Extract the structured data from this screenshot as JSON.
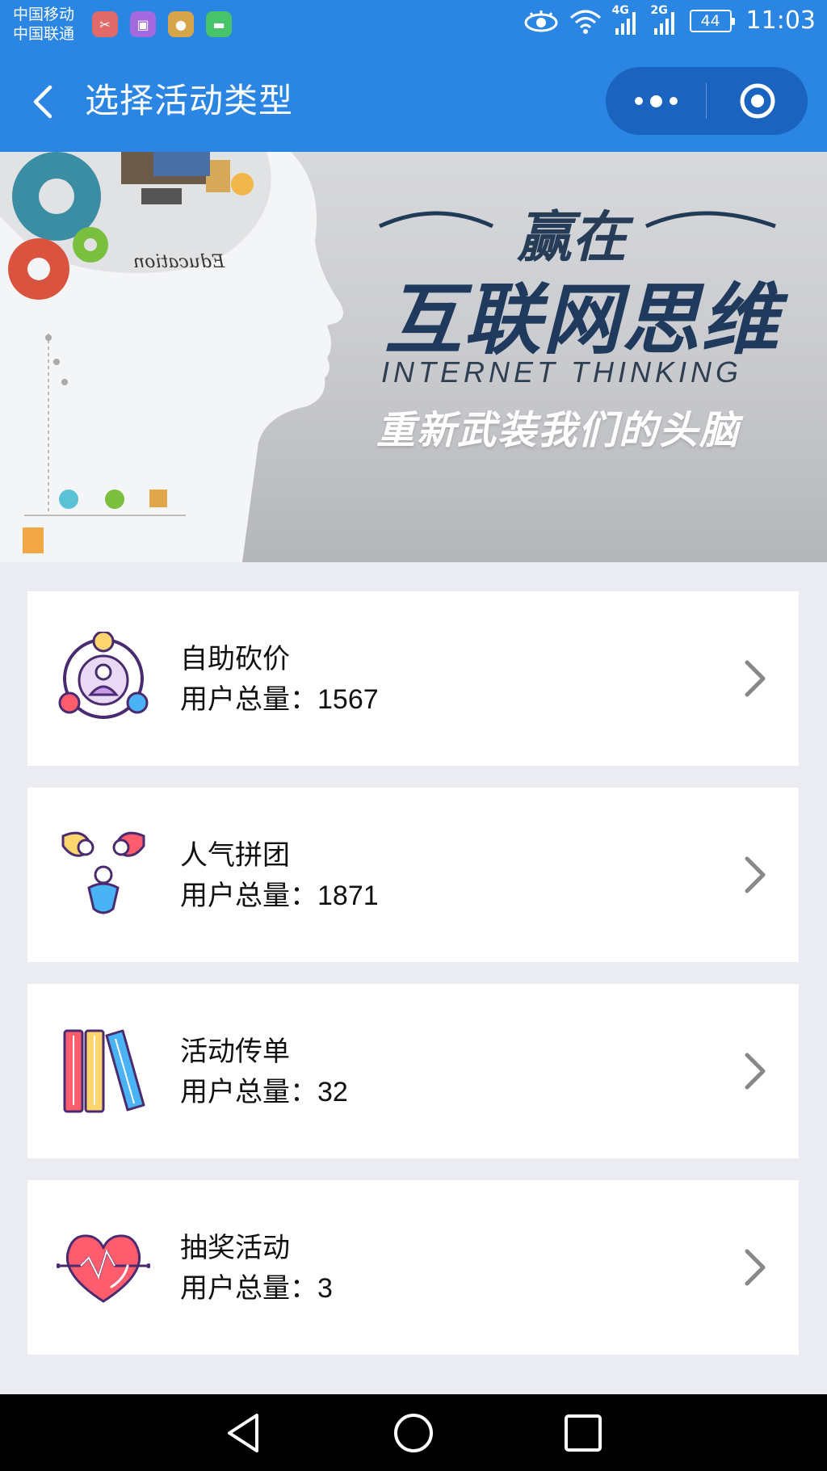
{
  "status_bar": {
    "carrier_1": "中国移动",
    "carrier_2": "中国联通",
    "net_1": "4G",
    "net_2": "2G",
    "battery": "44",
    "time": "11:03",
    "app_icons": [
      {
        "name": "scissors-app-icon",
        "color": "#e06a6a"
      },
      {
        "name": "image-app-icon",
        "color": "#a36ae0"
      },
      {
        "name": "badge-app-icon",
        "color": "#d7a64a"
      },
      {
        "name": "message-app-icon",
        "color": "#47c46a"
      }
    ]
  },
  "nav": {
    "title": "选择活动类型"
  },
  "banner": {
    "line_1": "赢在",
    "line_2": "互联网思维",
    "line_3": "INTERNET THINKING",
    "line_4": "重新武装我们的头脑",
    "edu_text": "Education"
  },
  "activities": [
    {
      "title": "自助砍价",
      "count_label": "用户总量：",
      "count": "1567",
      "icon": "bargain-people-icon"
    },
    {
      "title": "人气拼团",
      "count_label": "用户总量：",
      "count": "1871",
      "icon": "group-people-icon"
    },
    {
      "title": "活动传单",
      "count_label": "用户总量：",
      "count": "32",
      "icon": "books-flyer-icon"
    },
    {
      "title": "抽奖活动",
      "count_label": "用户总量：",
      "count": "3",
      "icon": "heart-pulse-icon"
    }
  ],
  "colors": {
    "primary": "#2b86e3",
    "capsule": "#1a63bf",
    "background": "#ebebf2"
  }
}
